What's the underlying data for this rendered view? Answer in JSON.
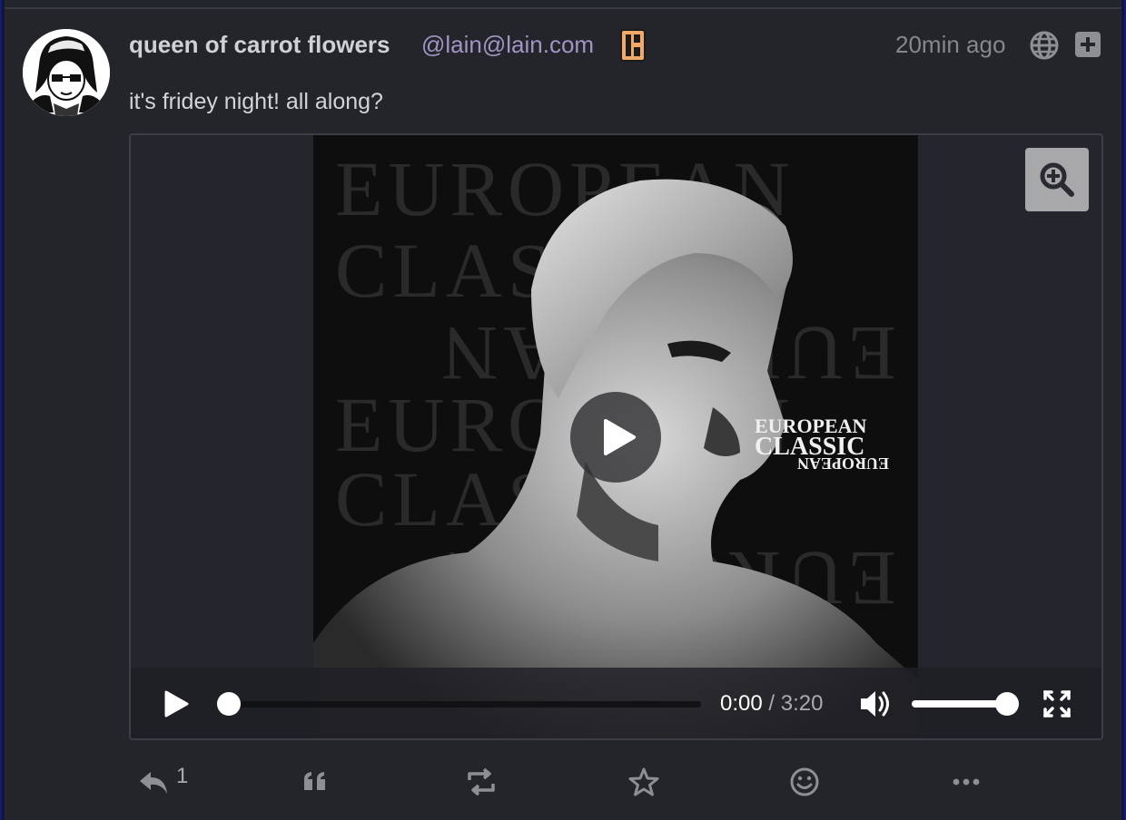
{
  "post": {
    "author": {
      "display_name": "queen of carrot flowers",
      "handle": "@lain@lain.com",
      "avatar_icon": "anime-girl-avatar",
      "bot_badge_icon": "bot-badge-icon"
    },
    "timestamp": "20min ago",
    "visibility_icon": "globe-icon",
    "expand_icon": "plus-square-icon",
    "text": "it's fridey night! all along?",
    "media": {
      "type": "audio-with-cover",
      "cover_text": {
        "line1": "EUROPEAN",
        "line2": "CLASSIC",
        "line3": "EUROPEAN"
      },
      "player": {
        "current_time": "0:00",
        "separator": "/",
        "duration": "3:20",
        "progress_percent": 0,
        "volume_percent": 100
      }
    },
    "actions": {
      "reply_count": "1"
    }
  },
  "colors": {
    "background": "#24252b",
    "handle": "#a294c4",
    "accent_badge": "#f1a869",
    "muted": "#86878d"
  }
}
